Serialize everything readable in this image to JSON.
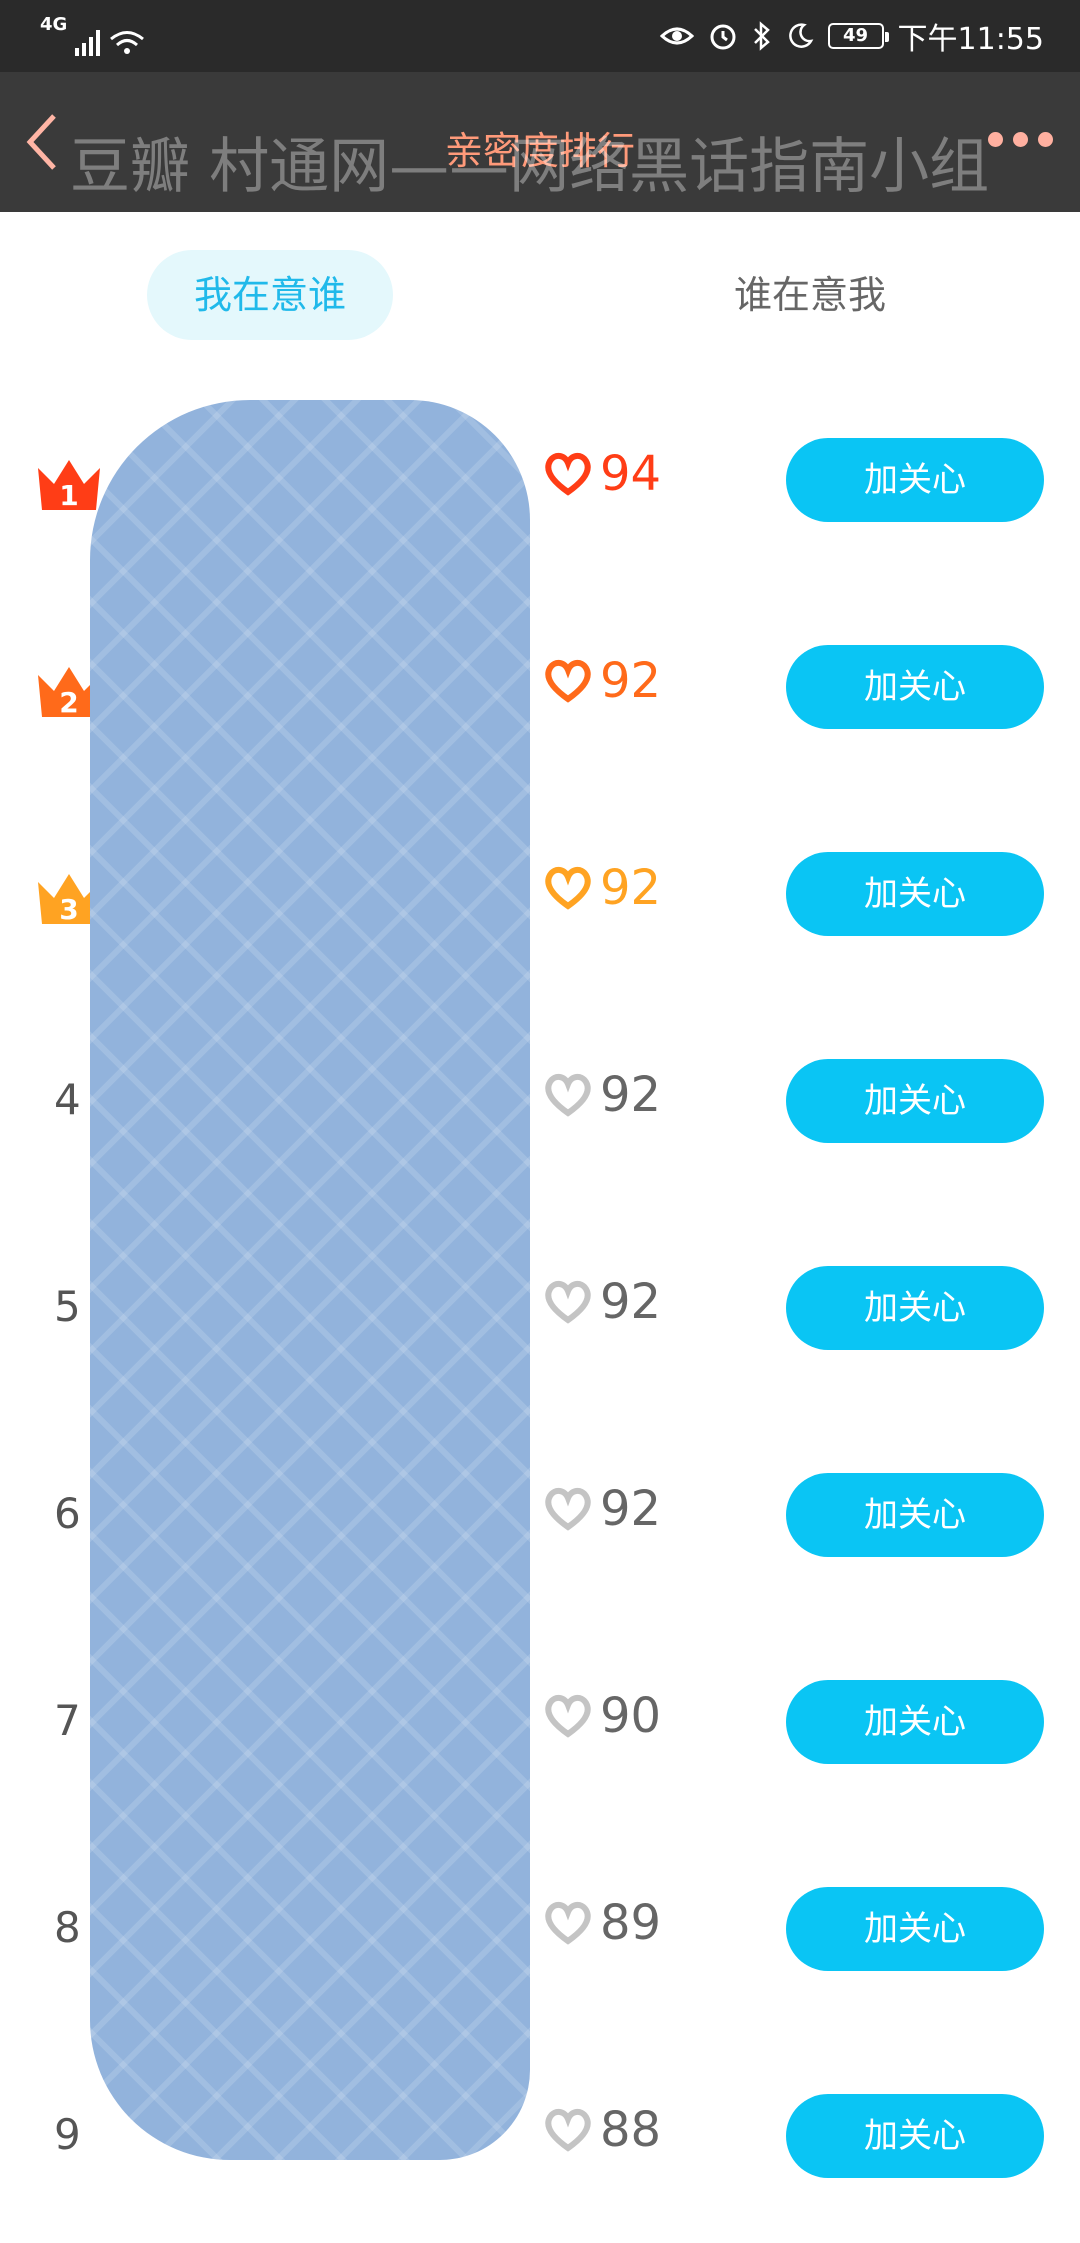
{
  "status_bar": {
    "network": "4G",
    "battery": "49",
    "time": "下午11:55"
  },
  "header": {
    "title": "亲密度排行",
    "watermark": "豆瓣 村通网——网络黑话指南小组"
  },
  "tabs": [
    {
      "label": "我在意谁",
      "active": true
    },
    {
      "label": "谁在意我",
      "active": false
    }
  ],
  "rows": [
    {
      "rank": "1",
      "score": "94"
    },
    {
      "rank": "2",
      "score": "92"
    },
    {
      "rank": "3",
      "score": "92"
    },
    {
      "rank": "4",
      "score": "92"
    },
    {
      "rank": "5",
      "score": "92"
    },
    {
      "rank": "6",
      "score": "92"
    },
    {
      "rank": "7",
      "score": "90"
    },
    {
      "rank": "8",
      "score": "89"
    },
    {
      "rank": "9",
      "score": "88"
    }
  ],
  "follow_label": "加关心",
  "colors": {
    "accent": "#0ac5f4",
    "tab_active_text": "#20b9ea",
    "rank1": "#ff3d16",
    "rank2": "#ff6a1a",
    "rank3": "#ffa322",
    "heart_gray": "#c4c4c4"
  },
  "icons": [
    "back-icon",
    "more-icon",
    "crown-icon",
    "heart-icon"
  ]
}
